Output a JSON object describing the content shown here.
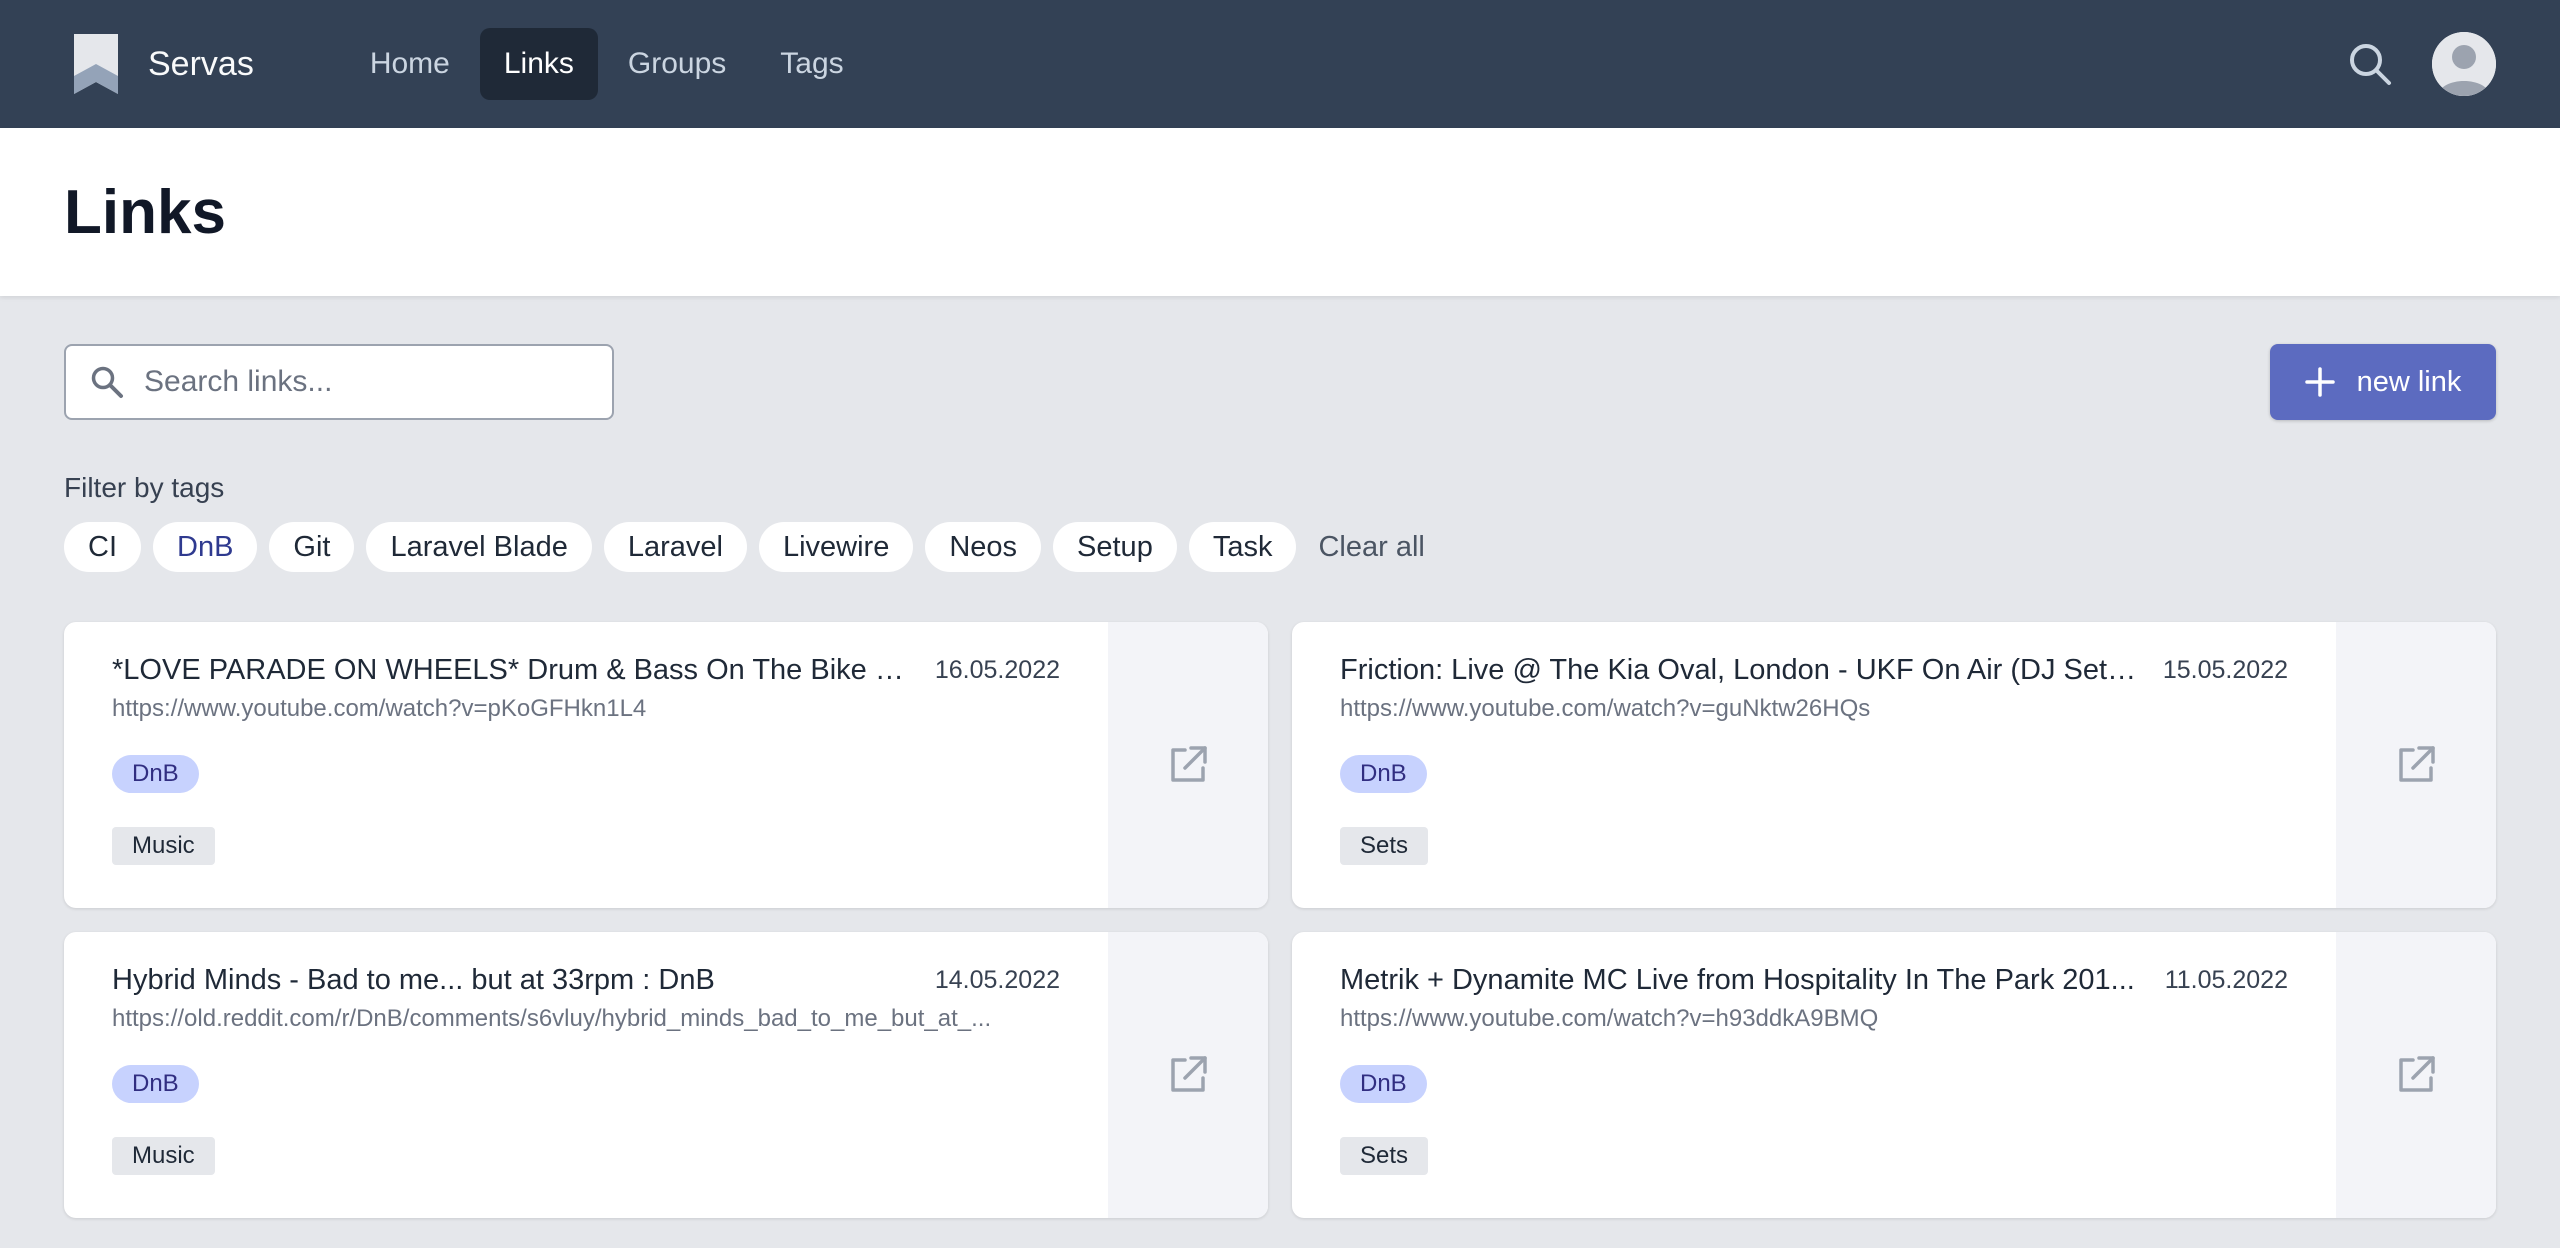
{
  "app": {
    "name": "Servas"
  },
  "nav": {
    "items": [
      {
        "label": "Home",
        "active": false
      },
      {
        "label": "Links",
        "active": true
      },
      {
        "label": "Groups",
        "active": false
      },
      {
        "label": "Tags",
        "active": false
      }
    ],
    "search_icon": "search-icon",
    "avatar_icon": "user-avatar-icon"
  },
  "page": {
    "title": "Links"
  },
  "search": {
    "placeholder": "Search links...",
    "value": ""
  },
  "new_link": {
    "label": "new link",
    "icon": "plus-icon"
  },
  "filter": {
    "label": "Filter by tags",
    "tags": [
      {
        "label": "CI",
        "active": false
      },
      {
        "label": "DnB",
        "active": true
      },
      {
        "label": "Git",
        "active": false
      },
      {
        "label": "Laravel Blade",
        "active": false
      },
      {
        "label": "Laravel",
        "active": false
      },
      {
        "label": "Livewire",
        "active": false
      },
      {
        "label": "Neos",
        "active": false
      },
      {
        "label": "Setup",
        "active": false
      },
      {
        "label": "Task",
        "active": false
      }
    ],
    "clear_label": "Clear all"
  },
  "links": [
    {
      "title": "*LOVE PARADE ON WHEELS* Drum & Bass On The Bike - B...",
      "date": "16.05.2022",
      "url": "https://www.youtube.com/watch?v=pKoGFHkn1L4",
      "tag": "DnB",
      "group": "Music"
    },
    {
      "title": "Friction: Live @ The Kia Oval, London - UKF On Air (DJ Set) ...",
      "date": "15.05.2022",
      "url": "https://www.youtube.com/watch?v=guNktw26HQs",
      "tag": "DnB",
      "group": "Sets"
    },
    {
      "title": "Hybrid Minds - Bad to me... but at 33rpm : DnB",
      "date": "14.05.2022",
      "url": "https://old.reddit.com/r/DnB/comments/s6vluy/hybrid_minds_bad_to_me_but_at_...",
      "tag": "DnB",
      "group": "Music"
    },
    {
      "title": "Metrik + Dynamite MC Live from Hospitality In The Park 201...",
      "date": "11.05.2022",
      "url": "https://www.youtube.com/watch?v=h93ddkA9BMQ",
      "tag": "DnB",
      "group": "Sets"
    }
  ],
  "colors": {
    "nav_bg": "#334155",
    "accent": "#5c6bc0",
    "tag_badge_bg": "#c7d2fe",
    "page_bg": "#e5e7eb"
  }
}
